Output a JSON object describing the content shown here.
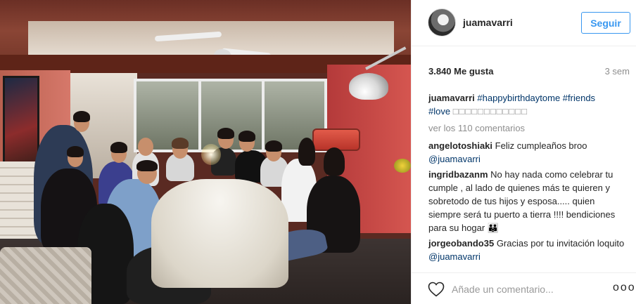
{
  "post": {
    "photo_alt": "Group photo of family and friends around a dinner table"
  },
  "header": {
    "username": "juamavarri",
    "follow_label": "Seguir"
  },
  "stats": {
    "likes": "3.840 Me gusta",
    "time_ago": "3 sem"
  },
  "caption": {
    "user": "juamavarri",
    "hashtags_line1": "#happybirthdaytome #friends",
    "hashtag_love": "#love",
    "emoji_placeholder": "□□□□□□□□□□□□"
  },
  "view_all_comments": "ver los 110 comentarios",
  "comments": [
    {
      "user": "angelotoshiaki",
      "text": "Feliz cumpleaños broo",
      "mention": "@juamavarri"
    },
    {
      "user": "ingridbazanm",
      "text": "No hay nada como celebrar tu cumple , al lado de quienes más te quieren y sobretodo de tus hijos y esposa..... quien siempre será tu puerto a tierra !!!! bendiciones para su hogar 👪"
    },
    {
      "user": "jorgeobando35",
      "text": "Gracias por tu invitación loquito",
      "mention": "@juamavarri"
    }
  ],
  "footer": {
    "comment_placeholder": "Añade un comentario...",
    "more_glyph": "ooo"
  },
  "icons": {
    "heart": "heart-icon",
    "more": "more-options-icon"
  }
}
